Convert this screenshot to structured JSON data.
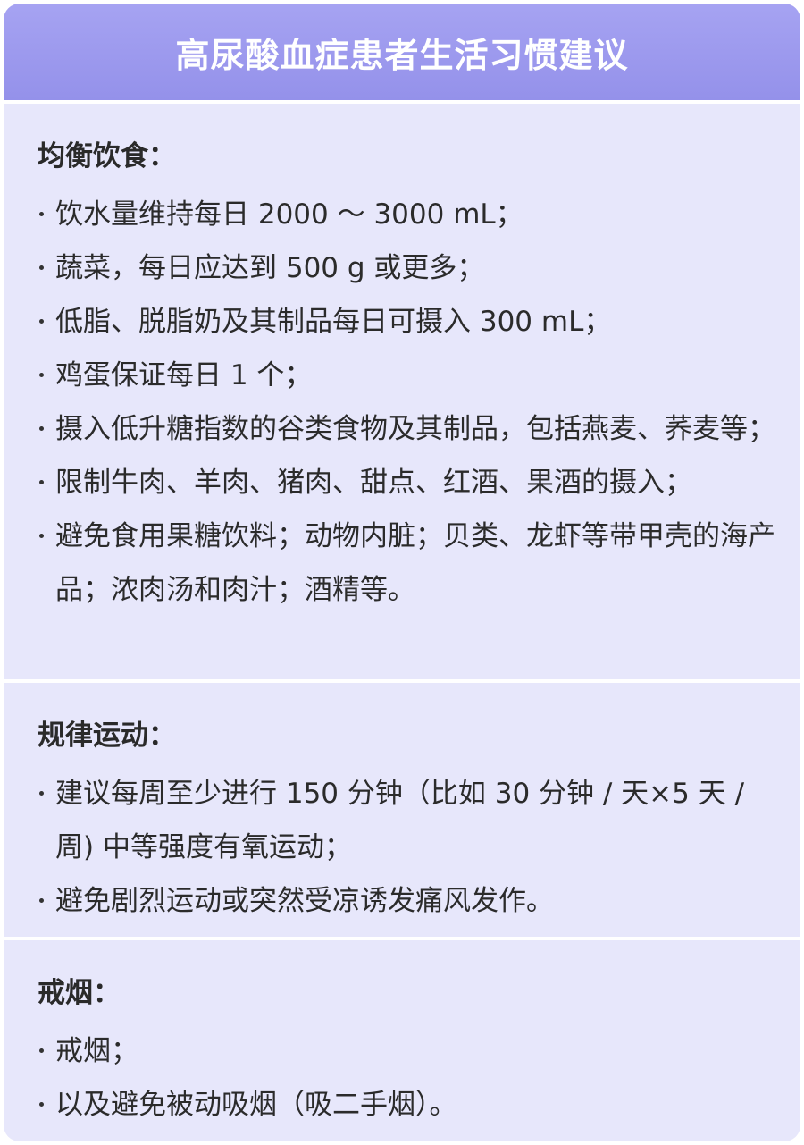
{
  "title": "高尿酸血症患者生活习惯建议",
  "sections": [
    {
      "heading": "均衡饮食：",
      "items": [
        "饮水量维持每日 2000 ～ 3000 mL；",
        "蔬菜，每日应达到 500 g 或更多；",
        "低脂、脱脂奶及其制品每日可摄入 300 mL；",
        "鸡蛋保证每日 1 个；",
        "摄入低升糖指数的谷类食物及其制品，包括燕麦、荞麦等；",
        "限制牛肉、羊肉、猪肉、甜点、红酒、果酒的摄入；",
        "避免食用果糖饮料；动物内脏；贝类、龙虾等带甲壳的海产品；浓肉汤和肉汁；酒精等。"
      ]
    },
    {
      "heading": "规律运动：",
      "items": [
        "建议每周至少进行 150 分钟（比如 30 分钟 / 天×5 天 / 周) 中等强度有氧运动；",
        "避免剧烈运动或突然受凉诱发痛风发作。"
      ]
    },
    {
      "heading": "戒烟：",
      "items": [
        "戒烟；",
        "以及避免被动吸烟（吸二手烟）。"
      ]
    }
  ],
  "colors": {
    "header_bg": "#9f9cf0",
    "section_bg": "#e7e7fb",
    "text": "#2b2b2b"
  }
}
